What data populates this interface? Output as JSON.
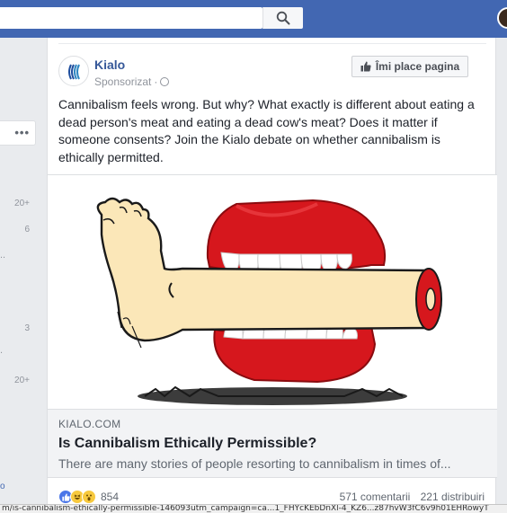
{
  "header": {
    "search_icon": "search-icon",
    "colors": {
      "bar": "#4267b2"
    }
  },
  "left_rail": {
    "more_label": "•••",
    "counts": [
      "20+",
      "6",
      "3",
      "20+"
    ]
  },
  "post": {
    "page_name": "Kialo",
    "sponsored_label": "Sponsorizat",
    "sponsored_separator": "·",
    "like_page_label": "Îmi place pagina",
    "text": "Cannibalism feels wrong. But why? What exactly is different about eating a dead person's meat and eating a dead cow's meat? Does it matter if someone consents? Join the Kialo debate on whether cannibalism is ethically permitted.",
    "link": {
      "domain": "KIALO.COM",
      "title": "Is Cannibalism Ethically Permissible?",
      "description": "There are many stories of people resorting to cannibalism in times of..."
    },
    "reactions": {
      "count": "854",
      "icons": [
        "like-icon",
        "haha-icon",
        "wow-icon"
      ]
    },
    "comments": "571 comentarii",
    "shares": "221 distribuiri"
  },
  "status_bar": {
    "url": "m/is-cannibalism-ethically-permissible-146093utm_campaign=ca...1_FHYcKEbDnXl-4_KZ6...z87hvW3fC6v9h01EHRowyT"
  }
}
